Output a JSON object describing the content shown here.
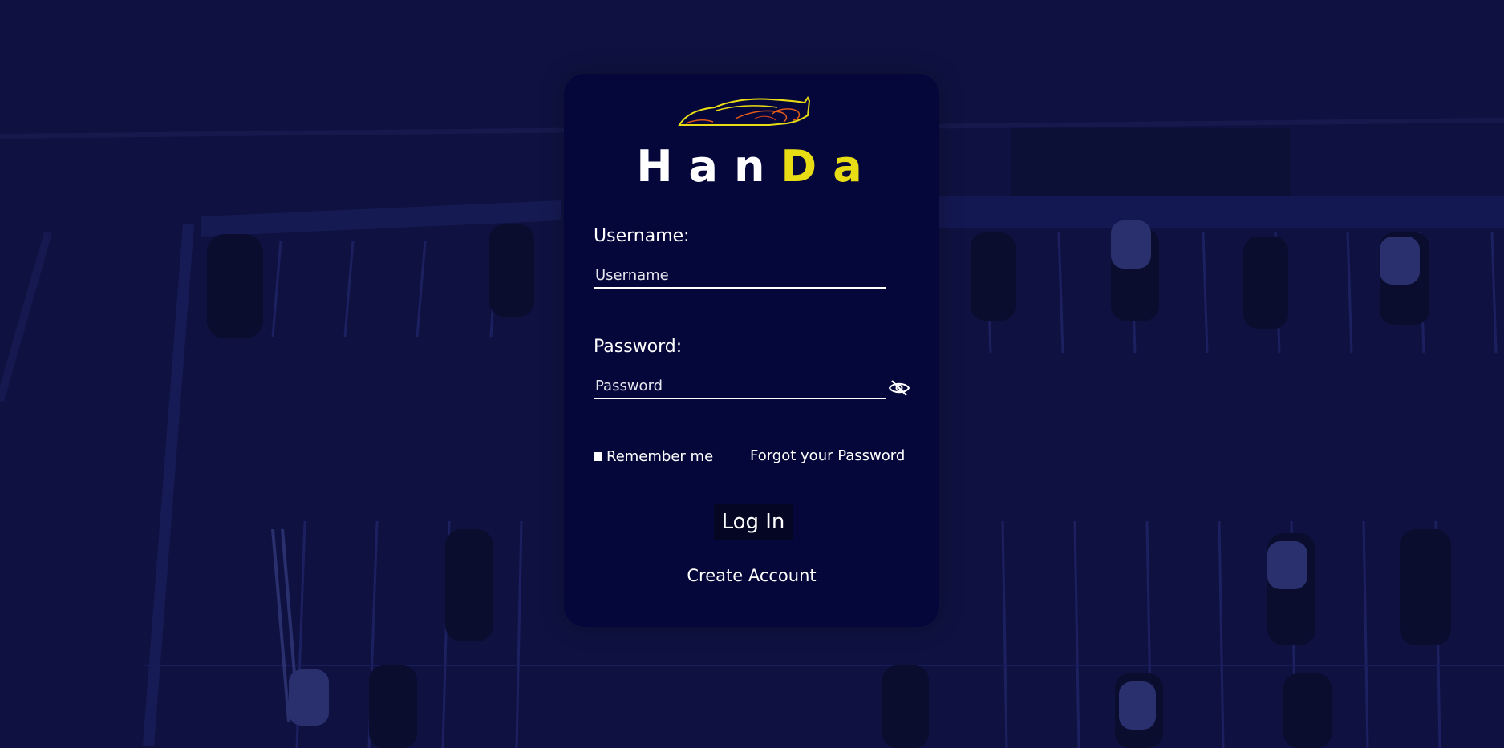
{
  "brand": {
    "name_main": "HanD",
    "name_prefix": "Han",
    "name_accent": "D",
    "name_suffix": "a",
    "accent_color": "#e8dc14"
  },
  "background": {
    "description": "parking-lot",
    "tint": "#0f1240"
  },
  "form": {
    "username_label": "Username:",
    "username_placeholder": "Username",
    "username_value": "",
    "password_label": "Password:",
    "password_placeholder": "Password",
    "password_value": "",
    "password_toggle_icon": "eye-slash-icon",
    "remember_label": "Remember me",
    "forgot_label": "Forgot your Password",
    "login_label": "Log In",
    "create_label": "Create Account"
  },
  "colors": {
    "card": "#05073a",
    "text": "#ffffff",
    "logo_car_outline": "#e8dc14",
    "logo_car_detail": "#e05a1a"
  }
}
